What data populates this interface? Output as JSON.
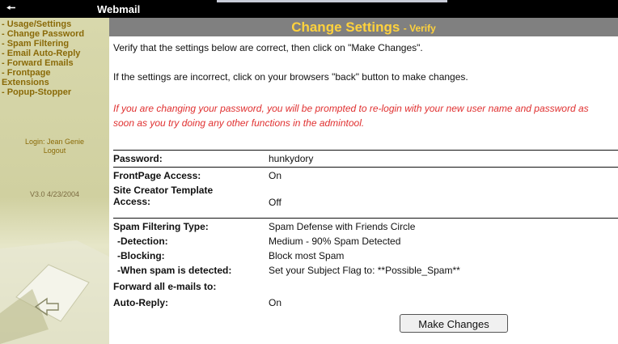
{
  "window": {
    "title": "Webmail"
  },
  "sidebar": {
    "items": [
      {
        "label": "- Usage/Settings"
      },
      {
        "label": "- Change Password"
      },
      {
        "label": "- Spam Filtering"
      },
      {
        "label": "- Email Auto-Reply"
      },
      {
        "label": "- Forward Emails"
      },
      {
        "label": "- Frontpage"
      },
      {
        "label": "Extensions"
      },
      {
        "label": "- Popup-Stopper"
      }
    ],
    "login_text": "Login: Jean Genie",
    "logout_label": "Logout",
    "version": "V3.0 4/23/2004"
  },
  "main": {
    "heading": "Change Settings",
    "heading_sub": "- Verify",
    "message1": "Verify that the settings below are correct, then click on \"Make Changes\".",
    "message2": "If the settings are incorrect, click on your browsers \"back\" button to make changes.",
    "warning": "If you are changing your password, you will be prompted to re-login with your new user name and password as soon as you try doing any other functions in the admintool."
  },
  "settings": {
    "password": {
      "label": "Password:",
      "value": "hunkydory"
    },
    "frontpage": {
      "label": "FrontPage Access:",
      "value": "On"
    },
    "site_creator": {
      "label": "Site Creator Template Access:",
      "value": "Off"
    },
    "spam_type": {
      "label": "Spam Filtering Type:",
      "value": "Spam Defense with Friends Circle"
    },
    "detection": {
      "label": "-Detection:",
      "value": "Medium - 90% Spam Detected"
    },
    "blocking": {
      "label": "-Blocking:",
      "value": "Block most Spam"
    },
    "when_spam": {
      "label": "-When spam is detected:",
      "value": "Set your Subject Flag to: **Possible_Spam**"
    },
    "forward": {
      "label": "Forward all e-mails to:",
      "value": ""
    },
    "autoreply": {
      "label": "Auto-Reply:",
      "value": "On"
    }
  },
  "actions": {
    "make_changes_label": "Make Changes"
  },
  "colors": {
    "heading_bar": "#808080",
    "heading_text": "#ffd23c",
    "warning_text": "#e03030",
    "nav_link": "#8a6a08"
  }
}
